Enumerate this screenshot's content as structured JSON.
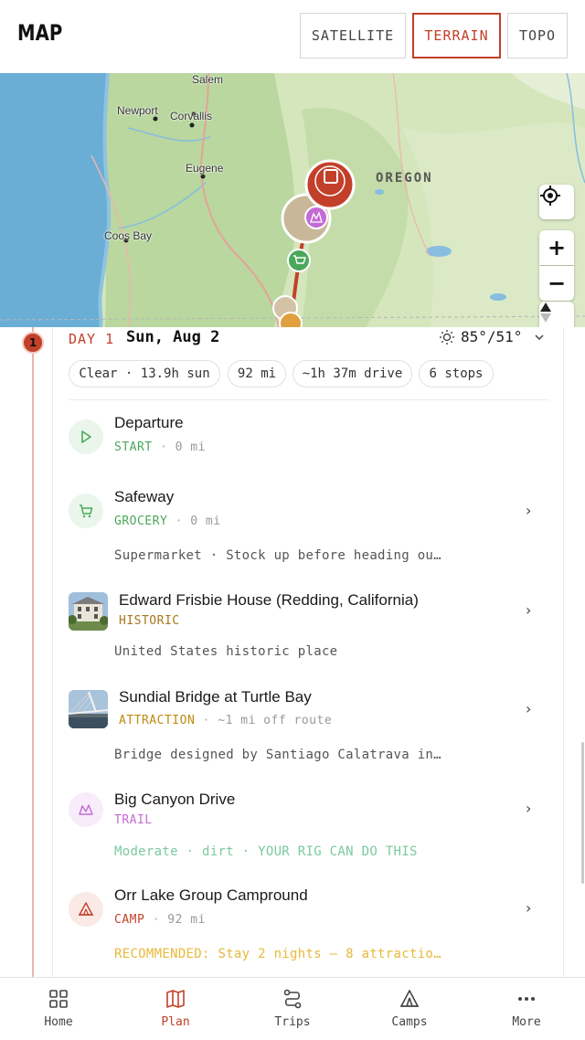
{
  "header": {
    "title": "MAP",
    "map_types": [
      "SATELLITE",
      "TERRAIN",
      "TOPO"
    ],
    "active_map_type": "TERRAIN"
  },
  "map": {
    "cities": {
      "salem": "Salem",
      "newport": "Newport",
      "corvallis": "Corvallis",
      "eugene": "Eugene",
      "coos_bay": "Coos Bay"
    },
    "state": "OREGON",
    "controls": [
      "locate-icon",
      "zoom-in-icon",
      "zoom-out-icon",
      "compass-icon"
    ]
  },
  "day": {
    "number": "1",
    "label": "DAY 1",
    "date": "Sun, Aug 2",
    "weather": "85°/51°",
    "pills": {
      "conditions": "Clear · 13.9h sun",
      "distance": "92 mi",
      "drive": "~1h 37m drive",
      "stops": "6 stops"
    }
  },
  "stops": [
    {
      "name": "Departure",
      "type": "START",
      "sep": "·",
      "extra": "0 mi",
      "desc": "",
      "type_color": "#4aa85a",
      "icon": "play-icon"
    },
    {
      "name": "Safeway",
      "type": "GROCERY",
      "sep": "·",
      "extra": "0 mi",
      "desc": "Supermarket · Stock up before heading ou…",
      "type_color": "#4aa85a",
      "icon": "cart-icon"
    },
    {
      "name": "Edward Frisbie House (Redding, California)",
      "type": "HISTORIC",
      "sep": "",
      "extra": "",
      "desc": "United States historic place",
      "type_color": "#a8771a",
      "icon": "house-photo"
    },
    {
      "name": "Sundial Bridge at Turtle Bay",
      "type": "ATTRACTION",
      "sep": "·",
      "extra": "~1 mi off route",
      "desc": "Bridge designed by Santiago Calatrava in…",
      "type_color": "#c08a10",
      "icon": "bridge-photo"
    },
    {
      "name": "Big Canyon Drive",
      "type": "TRAIL",
      "sep": "",
      "extra": "",
      "desc": "Moderate · dirt · YOUR RIG CAN DO THIS",
      "type_color": "#c46ad4",
      "icon": "mountain-icon"
    },
    {
      "name": "Orr Lake Group Campround",
      "type": "CAMP",
      "sep": "·",
      "extra": "92 mi",
      "desc": "RECOMMENDED: Stay 2 nights — 8 attractio…",
      "type_color": "#c2402a",
      "icon": "tent-icon"
    }
  ],
  "colors": {
    "accent": "#c2402a",
    "grocery_green": "#4aa85a",
    "trail_purple": "#c46ad4",
    "trail_desc_green": "#7cc9a0",
    "recommend_yellow": "#e8b93a"
  },
  "nav": {
    "items": [
      "Home",
      "Plan",
      "Trips",
      "Camps",
      "More"
    ],
    "active": "Plan"
  }
}
